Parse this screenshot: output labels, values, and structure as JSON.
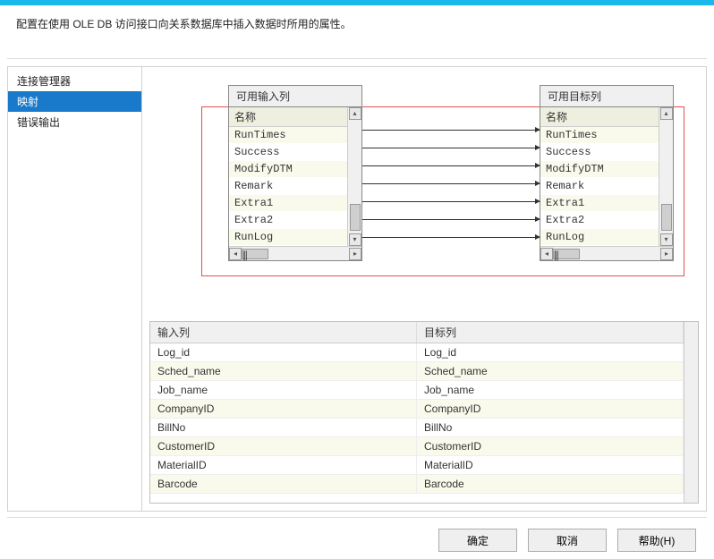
{
  "description": "配置在使用 OLE DB 访问接口向关系数据库中插入数据时所用的属性。",
  "sidebar": {
    "items": [
      {
        "label": "连接管理器",
        "selected": false
      },
      {
        "label": "映射",
        "selected": true
      },
      {
        "label": "错误输出",
        "selected": false
      }
    ]
  },
  "mapping": {
    "input_panel": {
      "title": "可用输入列",
      "header": "名称",
      "rows": [
        "RunTimes",
        "Success",
        "ModifyDTM",
        "Remark",
        "Extra1",
        "Extra2",
        "RunLog"
      ]
    },
    "target_panel": {
      "title": "可用目标列",
      "header": "名称",
      "rows": [
        "RunTimes",
        "Success",
        "ModifyDTM",
        "Remark",
        "Extra1",
        "Extra2",
        "RunLog"
      ]
    },
    "line_count": 7
  },
  "grid": {
    "headers": [
      "输入列",
      "目标列"
    ],
    "rows": [
      {
        "input": "Log_id",
        "target": "Log_id"
      },
      {
        "input": "Sched_name",
        "target": "Sched_name"
      },
      {
        "input": "Job_name",
        "target": "Job_name"
      },
      {
        "input": "CompanyID",
        "target": "CompanyID"
      },
      {
        "input": "BillNo",
        "target": "BillNo"
      },
      {
        "input": "CustomerID",
        "target": "CustomerID"
      },
      {
        "input": "MaterialID",
        "target": "MaterialID"
      },
      {
        "input": "Barcode",
        "target": "Barcode"
      }
    ]
  },
  "footer": {
    "ok": "确定",
    "cancel": "取消",
    "help": "帮助(H)"
  }
}
